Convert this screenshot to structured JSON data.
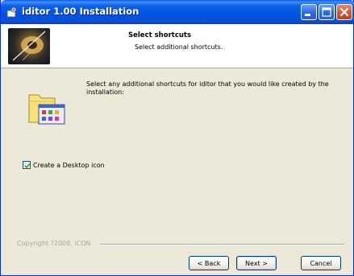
{
  "window": {
    "title": "iditor 1.00 Installation",
    "title_icon": "installer-icon",
    "controls": [
      "minimize-icon",
      "maximize-icon",
      "close-icon"
    ]
  },
  "header": {
    "title": "Select shortcuts",
    "subtitle": "Select additional shortcuts."
  },
  "body": {
    "description": "Select any additional shortcuts for iditor that you would like created by the installation:",
    "icon": "shortcuts-folder-icon",
    "checkbox_label": "Create a Desktop icon",
    "checkbox_checked": true
  },
  "footer": {
    "copyright": "Copyright ?2008, iCON",
    "back_label": "< Back",
    "next_label": "Next >",
    "cancel_label": "Cancel"
  }
}
